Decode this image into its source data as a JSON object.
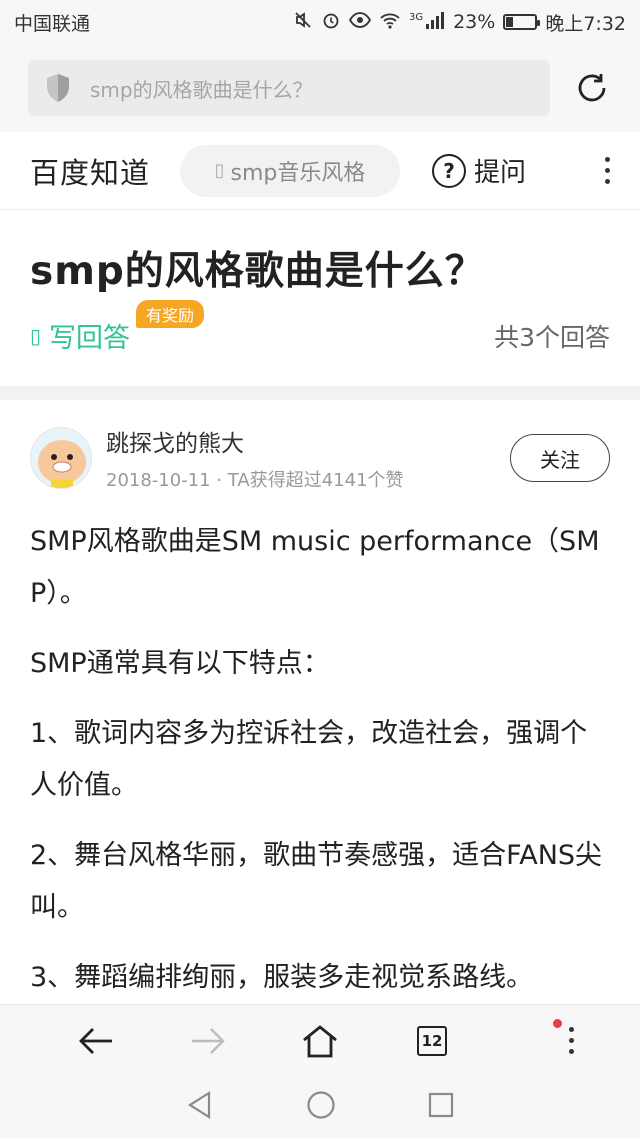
{
  "status_bar": {
    "carrier": "中国联通",
    "network_label": "3G",
    "battery_percent": "23%",
    "battery_level": 0.23,
    "time": "晚上7:32"
  },
  "url_bar": {
    "text": "smp的风格歌曲是什么？"
  },
  "site_header": {
    "logo": "百度知道",
    "search_text": "smp音乐风格",
    "ask_label": "提问"
  },
  "question": {
    "title": "smp的风格歌曲是什么？",
    "write_answer": "写回答",
    "reward_badge": "有奖励",
    "answer_count": "共3个回答"
  },
  "answer": {
    "author_name": "跳探戈的熊大",
    "date": "2018-10-11",
    "likes_text": "TA获得超过4141个赞",
    "follow_label": "关注",
    "paragraphs": [
      "SMP风格歌曲是SM music performance（SMP）。",
      "SMP通常具有以下特点：",
      "1、歌词内容多为控诉社会，改造社会，强调个人价值。",
      "2、舞台风格华丽，歌曲节奏感强，适合FANS尖叫。",
      "3、舞蹈编排绚丽，服装多走视觉系路线。"
    ]
  },
  "bottom_nav": {
    "tab_count": "12"
  },
  "colors": {
    "accent_green": "#32c397",
    "reward_orange": "#f5a623",
    "notification_red": "#ec3b3b"
  }
}
